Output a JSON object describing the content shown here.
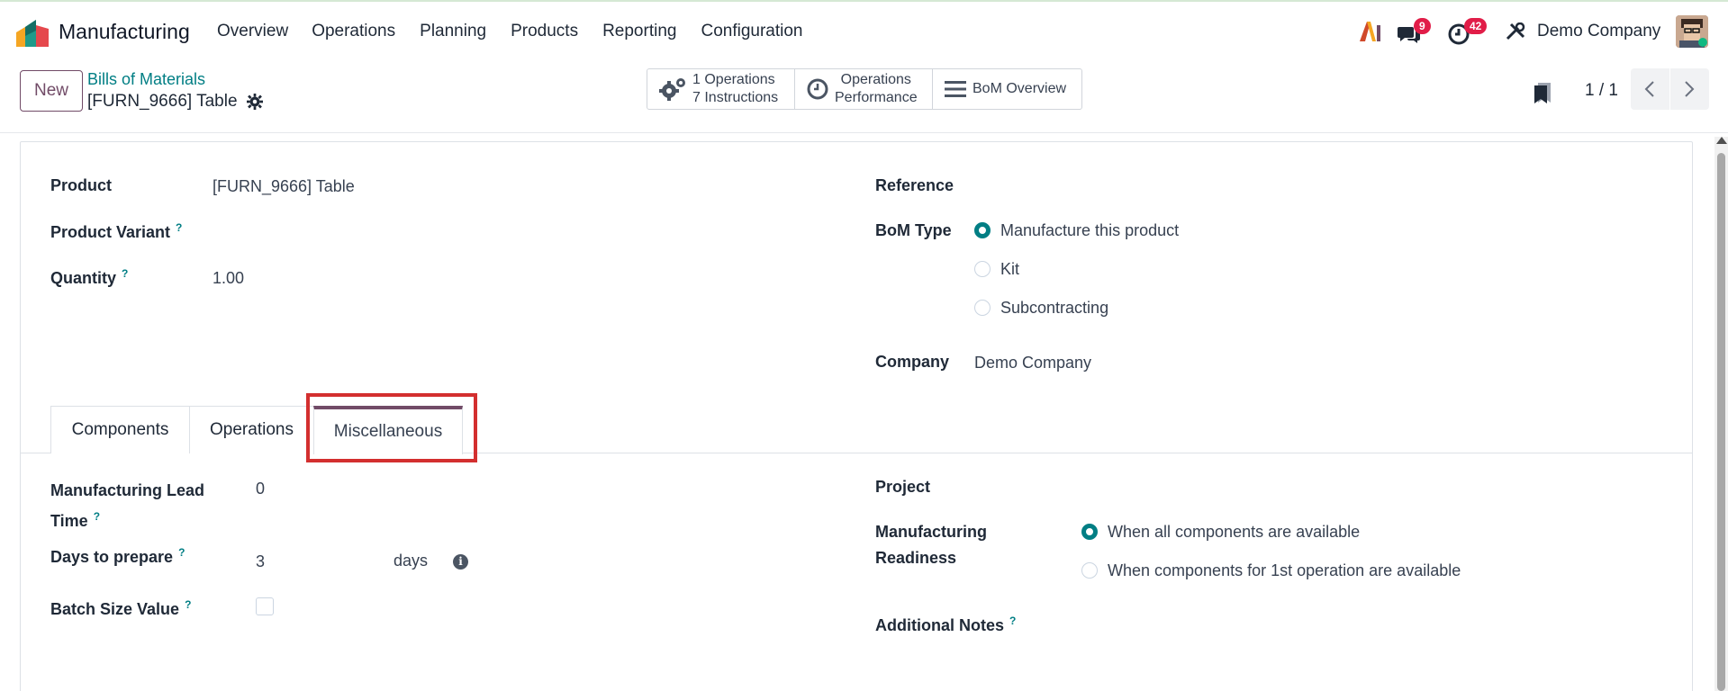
{
  "app": {
    "name": "Manufacturing"
  },
  "menu": [
    "Overview",
    "Operations",
    "Planning",
    "Products",
    "Reporting",
    "Configuration"
  ],
  "systray": {
    "messages_count": "9",
    "activities_count": "42",
    "company": "Demo Company"
  },
  "control": {
    "new_label": "New",
    "breadcrumb": "Bills of Materials",
    "record_name": "[FURN_9666] Table",
    "smart_buttons": {
      "operations_line1": "1 Operations",
      "operations_line2": "7 Instructions",
      "performance_line1": "Operations",
      "performance_line2": "Performance",
      "bom_overview": "BoM Overview"
    },
    "pager": "1 / 1"
  },
  "form": {
    "product_label": "Product",
    "product_value": "[FURN_9666] Table",
    "variant_label": "Product Variant",
    "quantity_label": "Quantity",
    "quantity_value": "1.00",
    "reference_label": "Reference",
    "bom_type_label": "BoM Type",
    "bom_types": [
      "Manufacture this product",
      "Kit",
      "Subcontracting"
    ],
    "bom_type_selected": "Manufacture this product",
    "company_label": "Company",
    "company_value": "Demo Company",
    "help_mark": "?"
  },
  "tabs": [
    "Components",
    "Operations",
    "Miscellaneous"
  ],
  "active_tab": "Miscellaneous",
  "misc": {
    "lead_time_label_1": "Manufacturing Lead",
    "lead_time_label_2": "Time",
    "lead_time_value": "0",
    "days_prepare_label": "Days to prepare",
    "days_prepare_value": "3",
    "days_unit": "days",
    "batch_label": "Batch Size Value",
    "project_label": "Project",
    "readiness_label_1": "Manufacturing",
    "readiness_label_2": "Readiness",
    "readiness_options": [
      "When all components are available",
      "When components for 1st operation are available"
    ],
    "readiness_selected": "When all components are available",
    "notes_label": "Additional Notes"
  },
  "colors": {
    "brand": "#714b67",
    "accent": "#017e84",
    "highlight": "#d32f2f",
    "badge": "#e11d48"
  }
}
